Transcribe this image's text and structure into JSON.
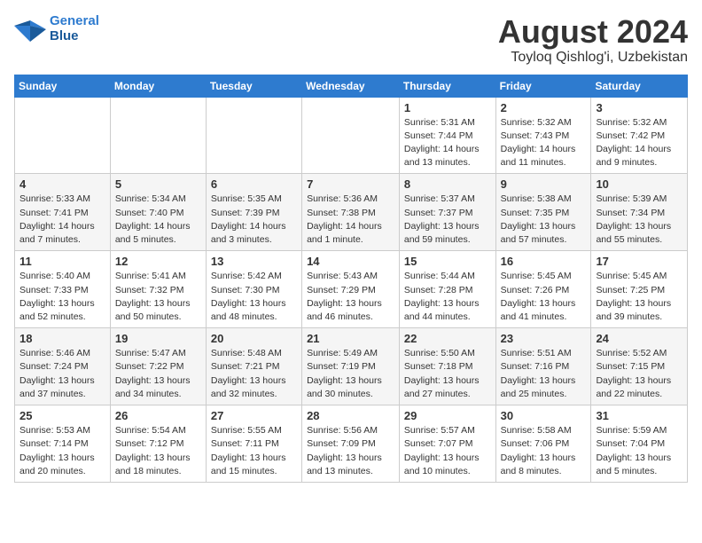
{
  "logo": {
    "line1": "General",
    "line2": "Blue"
  },
  "title": "August 2024",
  "location": "Toyloq Qishlog'i, Uzbekistan",
  "weekdays": [
    "Sunday",
    "Monday",
    "Tuesday",
    "Wednesday",
    "Thursday",
    "Friday",
    "Saturday"
  ],
  "weeks": [
    [
      {
        "day": "",
        "info": ""
      },
      {
        "day": "",
        "info": ""
      },
      {
        "day": "",
        "info": ""
      },
      {
        "day": "",
        "info": ""
      },
      {
        "day": "1",
        "info": "Sunrise: 5:31 AM\nSunset: 7:44 PM\nDaylight: 14 hours\nand 13 minutes."
      },
      {
        "day": "2",
        "info": "Sunrise: 5:32 AM\nSunset: 7:43 PM\nDaylight: 14 hours\nand 11 minutes."
      },
      {
        "day": "3",
        "info": "Sunrise: 5:32 AM\nSunset: 7:42 PM\nDaylight: 14 hours\nand 9 minutes."
      }
    ],
    [
      {
        "day": "4",
        "info": "Sunrise: 5:33 AM\nSunset: 7:41 PM\nDaylight: 14 hours\nand 7 minutes."
      },
      {
        "day": "5",
        "info": "Sunrise: 5:34 AM\nSunset: 7:40 PM\nDaylight: 14 hours\nand 5 minutes."
      },
      {
        "day": "6",
        "info": "Sunrise: 5:35 AM\nSunset: 7:39 PM\nDaylight: 14 hours\nand 3 minutes."
      },
      {
        "day": "7",
        "info": "Sunrise: 5:36 AM\nSunset: 7:38 PM\nDaylight: 14 hours\nand 1 minute."
      },
      {
        "day": "8",
        "info": "Sunrise: 5:37 AM\nSunset: 7:37 PM\nDaylight: 13 hours\nand 59 minutes."
      },
      {
        "day": "9",
        "info": "Sunrise: 5:38 AM\nSunset: 7:35 PM\nDaylight: 13 hours\nand 57 minutes."
      },
      {
        "day": "10",
        "info": "Sunrise: 5:39 AM\nSunset: 7:34 PM\nDaylight: 13 hours\nand 55 minutes."
      }
    ],
    [
      {
        "day": "11",
        "info": "Sunrise: 5:40 AM\nSunset: 7:33 PM\nDaylight: 13 hours\nand 52 minutes."
      },
      {
        "day": "12",
        "info": "Sunrise: 5:41 AM\nSunset: 7:32 PM\nDaylight: 13 hours\nand 50 minutes."
      },
      {
        "day": "13",
        "info": "Sunrise: 5:42 AM\nSunset: 7:30 PM\nDaylight: 13 hours\nand 48 minutes."
      },
      {
        "day": "14",
        "info": "Sunrise: 5:43 AM\nSunset: 7:29 PM\nDaylight: 13 hours\nand 46 minutes."
      },
      {
        "day": "15",
        "info": "Sunrise: 5:44 AM\nSunset: 7:28 PM\nDaylight: 13 hours\nand 44 minutes."
      },
      {
        "day": "16",
        "info": "Sunrise: 5:45 AM\nSunset: 7:26 PM\nDaylight: 13 hours\nand 41 minutes."
      },
      {
        "day": "17",
        "info": "Sunrise: 5:45 AM\nSunset: 7:25 PM\nDaylight: 13 hours\nand 39 minutes."
      }
    ],
    [
      {
        "day": "18",
        "info": "Sunrise: 5:46 AM\nSunset: 7:24 PM\nDaylight: 13 hours\nand 37 minutes."
      },
      {
        "day": "19",
        "info": "Sunrise: 5:47 AM\nSunset: 7:22 PM\nDaylight: 13 hours\nand 34 minutes."
      },
      {
        "day": "20",
        "info": "Sunrise: 5:48 AM\nSunset: 7:21 PM\nDaylight: 13 hours\nand 32 minutes."
      },
      {
        "day": "21",
        "info": "Sunrise: 5:49 AM\nSunset: 7:19 PM\nDaylight: 13 hours\nand 30 minutes."
      },
      {
        "day": "22",
        "info": "Sunrise: 5:50 AM\nSunset: 7:18 PM\nDaylight: 13 hours\nand 27 minutes."
      },
      {
        "day": "23",
        "info": "Sunrise: 5:51 AM\nSunset: 7:16 PM\nDaylight: 13 hours\nand 25 minutes."
      },
      {
        "day": "24",
        "info": "Sunrise: 5:52 AM\nSunset: 7:15 PM\nDaylight: 13 hours\nand 22 minutes."
      }
    ],
    [
      {
        "day": "25",
        "info": "Sunrise: 5:53 AM\nSunset: 7:14 PM\nDaylight: 13 hours\nand 20 minutes."
      },
      {
        "day": "26",
        "info": "Sunrise: 5:54 AM\nSunset: 7:12 PM\nDaylight: 13 hours\nand 18 minutes."
      },
      {
        "day": "27",
        "info": "Sunrise: 5:55 AM\nSunset: 7:11 PM\nDaylight: 13 hours\nand 15 minutes."
      },
      {
        "day": "28",
        "info": "Sunrise: 5:56 AM\nSunset: 7:09 PM\nDaylight: 13 hours\nand 13 minutes."
      },
      {
        "day": "29",
        "info": "Sunrise: 5:57 AM\nSunset: 7:07 PM\nDaylight: 13 hours\nand 10 minutes."
      },
      {
        "day": "30",
        "info": "Sunrise: 5:58 AM\nSunset: 7:06 PM\nDaylight: 13 hours\nand 8 minutes."
      },
      {
        "day": "31",
        "info": "Sunrise: 5:59 AM\nSunset: 7:04 PM\nDaylight: 13 hours\nand 5 minutes."
      }
    ]
  ]
}
